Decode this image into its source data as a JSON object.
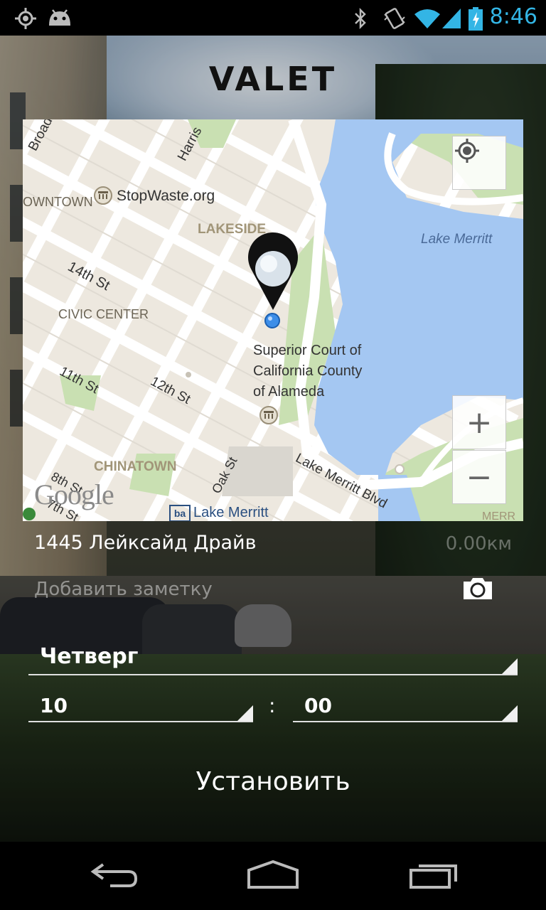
{
  "status_bar": {
    "time": "8:46",
    "icons": [
      "location-icon",
      "android-icon",
      "bluetooth-icon",
      "vibrate-icon",
      "wifi-icon",
      "signal-icon",
      "battery-charging-icon"
    ],
    "accent_color": "#33b5e5"
  },
  "app": {
    "title": "VALET"
  },
  "map": {
    "labels": {
      "broadway": "Broadway",
      "harrison": "Harris",
      "downtown": "OWNTOWN",
      "stopwaste": "StopWaste.org",
      "lakeside": "LAKESIDE",
      "lake_merritt_water": "Lake Merritt",
      "st14": "14th St",
      "civic_center": "CIVIC CENTER",
      "court_line1": "Superior Court of",
      "court_line2": "California County",
      "court_line3": "of Alameda",
      "st11": "11th St",
      "st12": "12th St",
      "chinatown": "CHINATOWN",
      "oak_st": "Oak St",
      "lake_merritt_blvd": "Lake Merritt Blvd",
      "st8": "8th St",
      "st7": "7th St",
      "bart_station": "Lake Merritt",
      "merr": "MERR",
      "google": "Google"
    },
    "controls": {
      "my_location": "my-location-icon",
      "zoom_in": "+",
      "zoom_out": "−"
    },
    "colors": {
      "water": "#a4c7f2",
      "park": "#c9e0b2",
      "land": "#ede8df",
      "road": "#ffffff"
    }
  },
  "location": {
    "address": "1445 Лейксайд Драйв",
    "distance": "0.00км"
  },
  "note": {
    "placeholder": "Добавить заметку"
  },
  "schedule": {
    "day": "Четверг",
    "hour": "10",
    "separator": ":",
    "minute": "00"
  },
  "actions": {
    "set_label": "Установить"
  },
  "nav": {
    "back": "back-icon",
    "home": "home-icon",
    "recents": "recents-icon"
  }
}
